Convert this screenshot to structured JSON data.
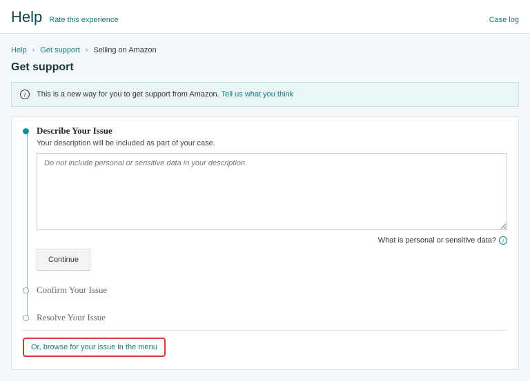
{
  "topbar": {
    "title": "Help",
    "rate_link": "Rate this experience",
    "case_log": "Case log"
  },
  "breadcrumb": {
    "items": [
      {
        "label": "Help",
        "link": true
      },
      {
        "label": "Get support",
        "link": true
      },
      {
        "label": "Selling on Amazon",
        "link": false
      }
    ]
  },
  "page_title": "Get support",
  "banner": {
    "text": "This is a new way for you to get support from Amazon.",
    "link": "Tell us what you think"
  },
  "steps": {
    "describe": {
      "title": "Describe Your Issue",
      "subtitle": "Your description will be included as part of your case.",
      "placeholder": "Do not include personal or sensitive data in your description.",
      "sensitive_help": "What is personal or sensitive data?",
      "continue": "Continue"
    },
    "confirm": {
      "title": "Confirm Your Issue"
    },
    "resolve": {
      "title": "Resolve Your Issue"
    }
  },
  "browse_link": "Or, browse for your issue in the menu"
}
